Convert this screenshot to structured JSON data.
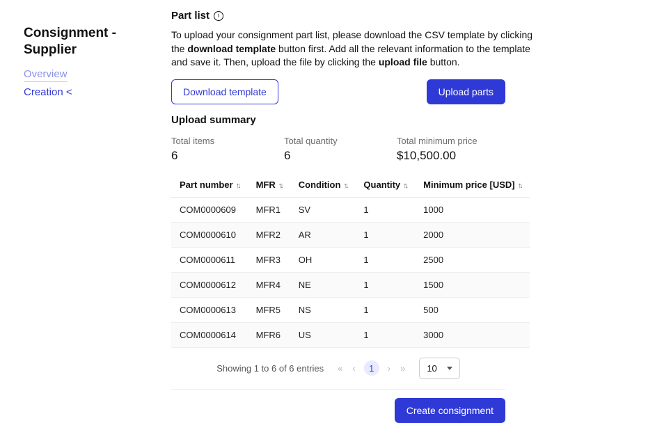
{
  "sidebar": {
    "title": "Consignment - Supplier",
    "links": {
      "overview": "Overview",
      "creation": "Creation <"
    }
  },
  "partlist": {
    "heading": "Part list",
    "desc_pre": "To upload your consignment part list, please download the CSV template by clicking the ",
    "desc_b1": "download template",
    "desc_mid": " button first. Add all the relevant information to the template and save it. Then, upload the file by clicking the ",
    "desc_b2": "upload file",
    "desc_end": " button."
  },
  "buttons": {
    "download": "Download template",
    "upload": "Upload parts",
    "create": "Create consignment"
  },
  "summary": {
    "heading": "Upload summary",
    "total_items_label": "Total items",
    "total_items": "6",
    "total_qty_label": "Total quantity",
    "total_qty": "6",
    "total_min_label": "Total minimum price",
    "total_min": "$10,500.00"
  },
  "table": {
    "headers": {
      "part": "Part number",
      "mfr": "MFR",
      "cond": "Condition",
      "qty": "Quantity",
      "price": "Minimum price [USD]"
    },
    "rows": [
      {
        "part": "COM0000609",
        "mfr": "MFR1",
        "cond": "SV",
        "qty": "1",
        "price": "1000"
      },
      {
        "part": "COM0000610",
        "mfr": "MFR2",
        "cond": "AR",
        "qty": "1",
        "price": "2000"
      },
      {
        "part": "COM0000611",
        "mfr": "MFR3",
        "cond": "OH",
        "qty": "1",
        "price": "2500"
      },
      {
        "part": "COM0000612",
        "mfr": "MFR4",
        "cond": "NE",
        "qty": "1",
        "price": "1500"
      },
      {
        "part": "COM0000613",
        "mfr": "MFR5",
        "cond": "NS",
        "qty": "1",
        "price": "500"
      },
      {
        "part": "COM0000614",
        "mfr": "MFR6",
        "cond": "US",
        "qty": "1",
        "price": "3000"
      }
    ]
  },
  "pager": {
    "text": "Showing 1 to 6 of 6 entries",
    "current": "1",
    "page_size": "10"
  }
}
